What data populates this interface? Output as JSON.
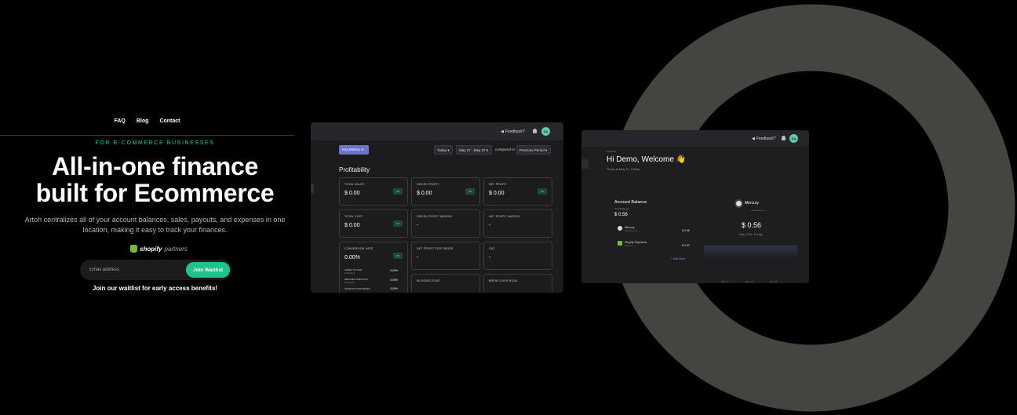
{
  "nav": {
    "items": [
      "FAQ",
      "Blog",
      "Contact"
    ]
  },
  "hero": {
    "eyebrow": "FOR E-COMMERCE BUSINESSES",
    "headline_line1": "All-in-one finance",
    "headline_line2": "built for Ecommerce",
    "description": "Artoh centralizes all of your account balances, sales, payouts, and expenses in one location, making it easy to track your finances.",
    "partner_brand": "shopify",
    "partner_suffix": "partners",
    "email_placeholder": "Email address",
    "join_button": "Join Waitlist",
    "early_access": "Join our waitlist for early access benefits!"
  },
  "dashboard1": {
    "feedback": "Feedback?",
    "avatar": "DA",
    "key_metrics": "Key Metrics",
    "period": "Today",
    "range": "May 27 - May 27",
    "compared_to": "compared to",
    "compare_period": "Previous Period",
    "section_title": "Profitability",
    "metrics": [
      {
        "title": "TOTAL SALES",
        "value": "$ 0.00",
        "pct": "0%"
      },
      {
        "title": "GROSS PROFIT",
        "value": "$ 0.00",
        "pct": "0%"
      },
      {
        "title": "NET PROFIT",
        "value": "$ 0.00",
        "pct": "0%"
      },
      {
        "title": "TOTAL COST",
        "value": "$ 0.00",
        "pct": "0%"
      },
      {
        "title": "GROSS PROFIT MARGIN",
        "value": "-"
      },
      {
        "title": "NET PROFIT MARGIN",
        "value": "-"
      },
      {
        "title": "CONVERSION RATE",
        "value": "0.00%",
        "pct": "0%"
      },
      {
        "title": "NET PROFIT PER ORDER",
        "value": "-"
      },
      {
        "title": "CAC",
        "value": "-"
      },
      {
        "title": "BLENDED ROAS",
        "value": ""
      },
      {
        "title": "BREAK-EVEN ROAS",
        "value": ""
      }
    ],
    "conversion_rows": [
      {
        "label": "ADDED TO CART",
        "sub": "0 sessions",
        "value": "0.00%"
      },
      {
        "label": "REACHED CHECKOUT",
        "sub": "0 sessions",
        "value": "0.00%"
      },
      {
        "label": "SESSIONS CONVERTED",
        "sub": "",
        "value": "0.00%"
      }
    ]
  },
  "dashboard2": {
    "feedback": "Feedback?",
    "avatar": "DA",
    "tag": "testArtoh",
    "welcome": "Hi Demo, Welcome 👋",
    "date": "Today is May 27, Friday",
    "account_balance_title": "Account Balance",
    "account_balance_sub": "Total Balance",
    "account_balance_value": "$ 0.56",
    "accounts": [
      {
        "name": "Mercury",
        "sub": "Checking ••••••",
        "value": "$ 0.56"
      },
      {
        "name": "Shopify Payments",
        "sub": "Synced ✓",
        "value": "$ 0.00"
      }
    ],
    "add_more": "+ Add More",
    "selected_name": "Mercury",
    "selected_sub": "Checking ••••••",
    "selected_value": "$ 0.56",
    "selected_date": "May 27th, Friday",
    "axis_labels": [
      "May 27",
      "May 27",
      "May 28"
    ]
  }
}
